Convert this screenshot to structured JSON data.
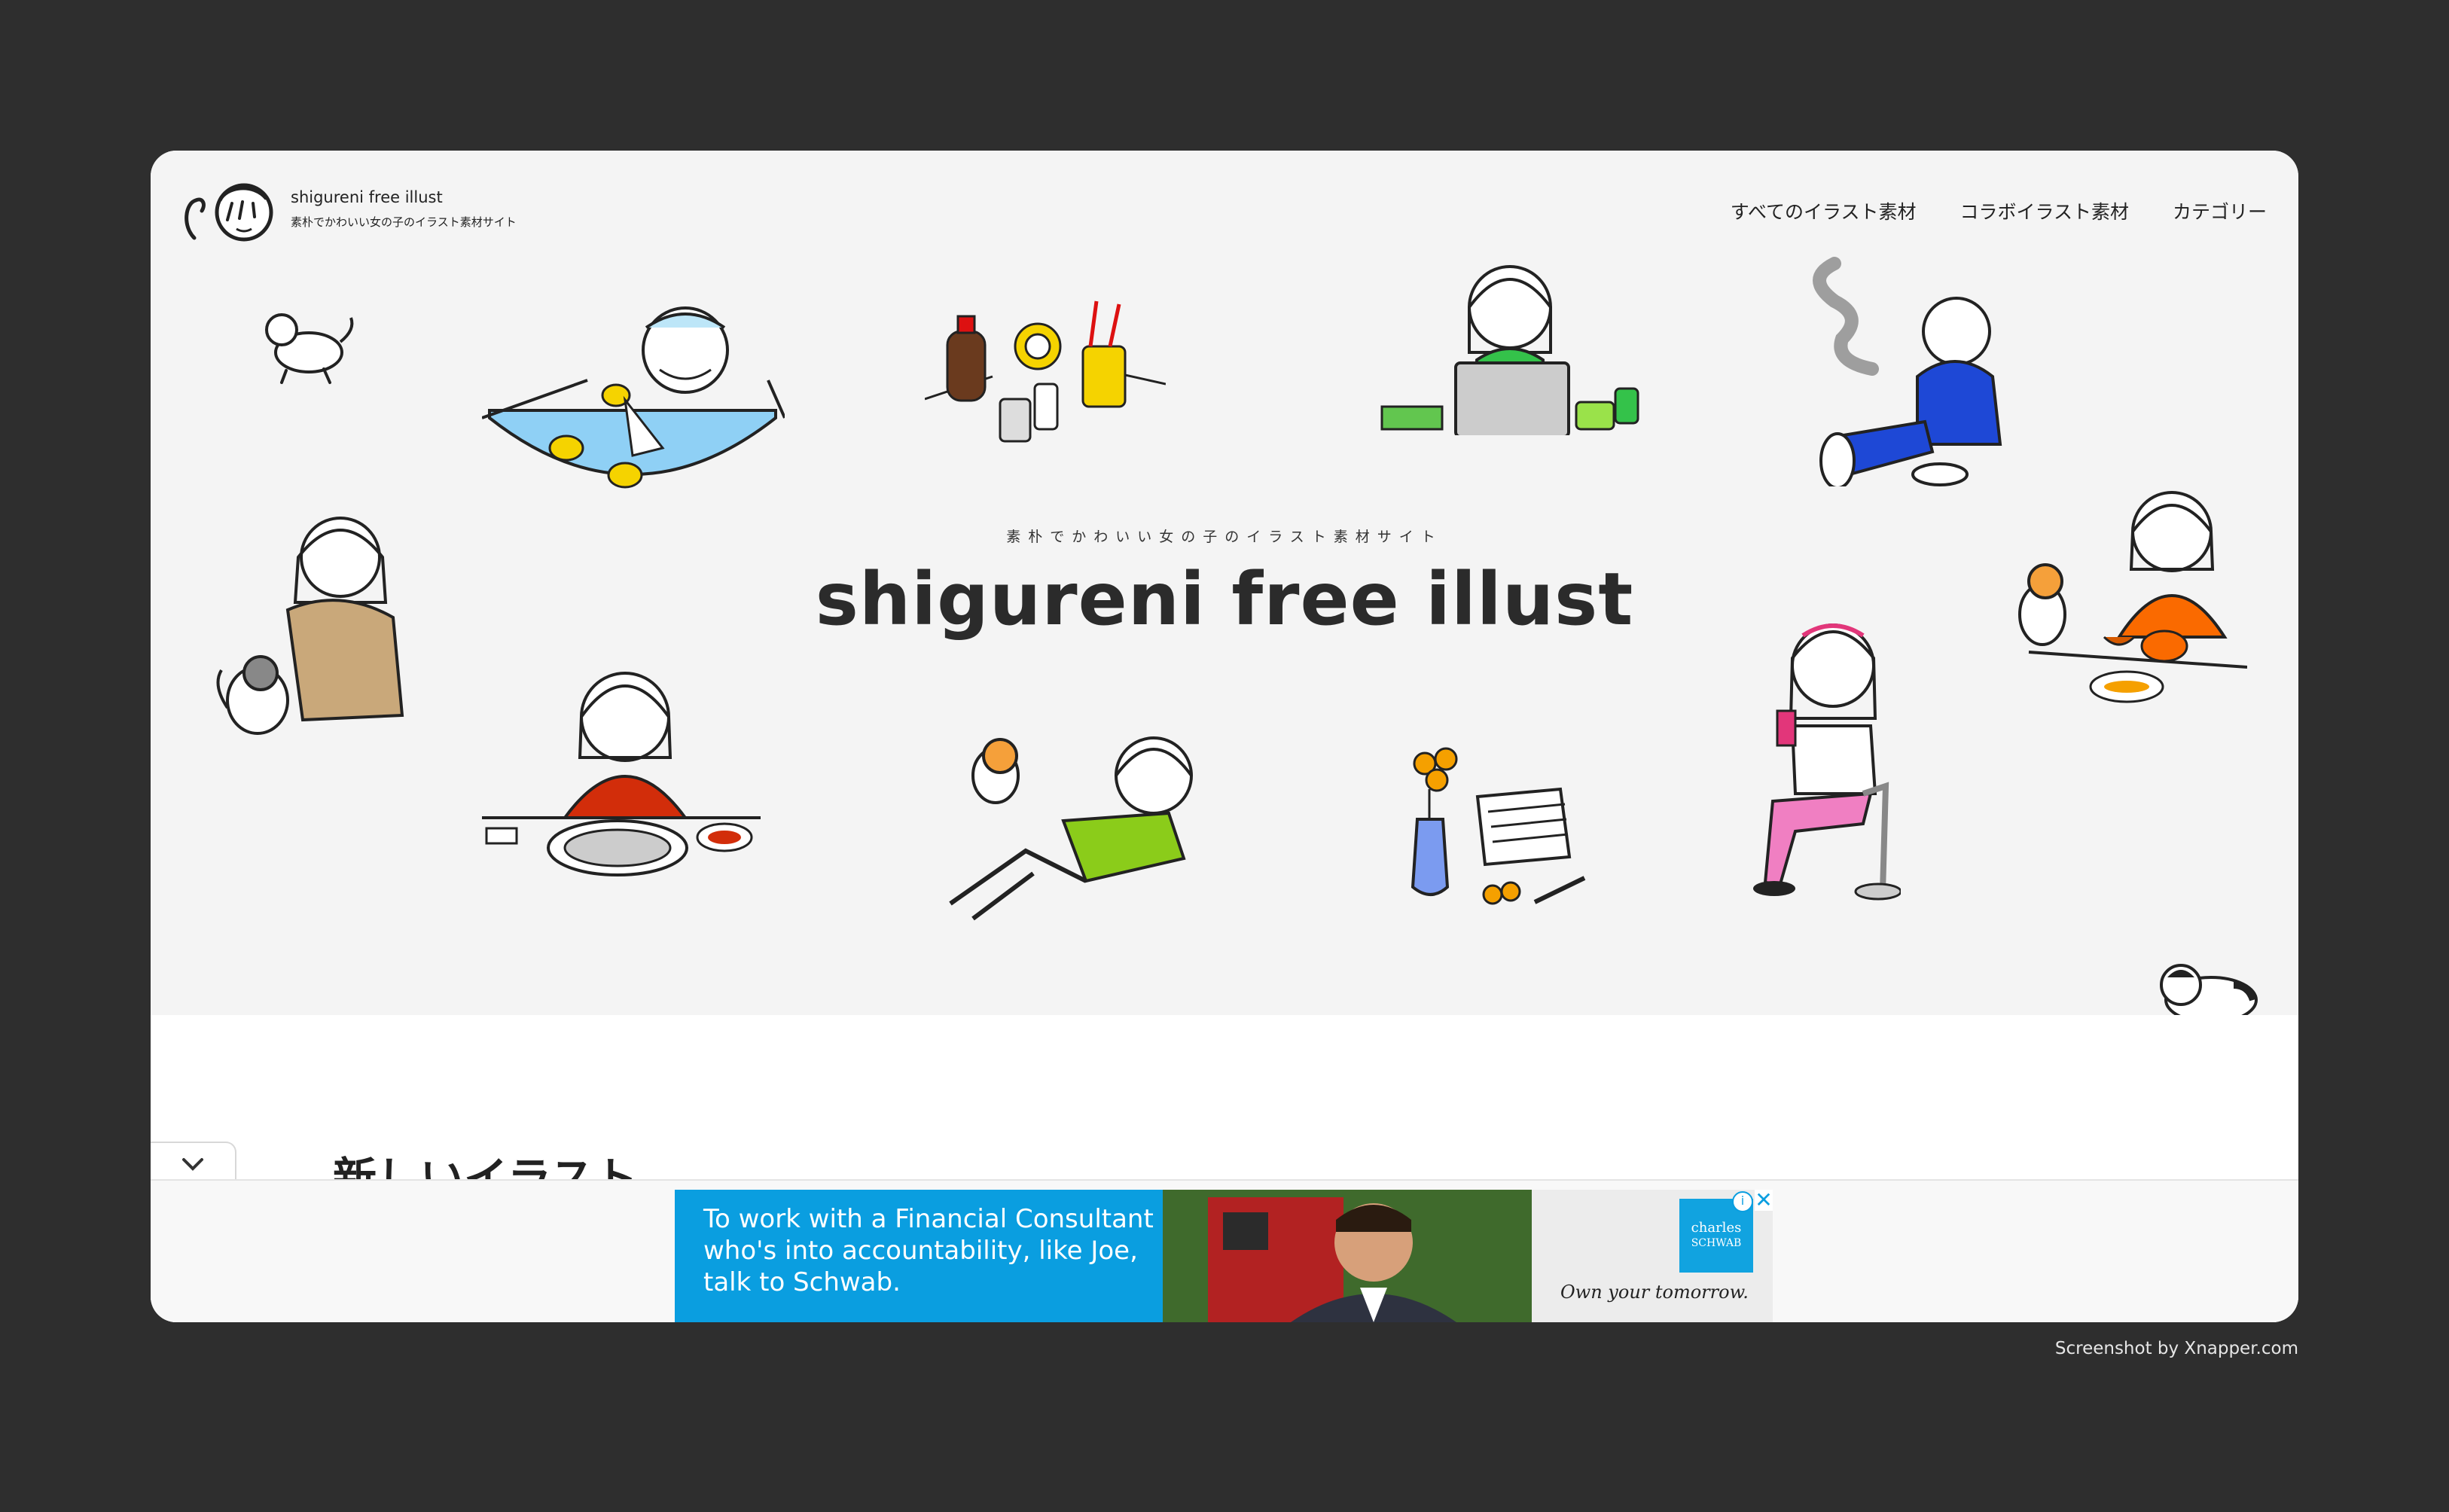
{
  "site": {
    "logo_title": "shigureni free illust",
    "logo_subtitle": "素朴でかわいい女の子のイラスト素材サイト",
    "tagline": "素朴でかわいい女の子のイラスト素材サイト",
    "title": "shigureni free illust"
  },
  "nav": {
    "items": [
      "すべてのイラスト素材",
      "コラボイラスト素材",
      "カテゴリー"
    ]
  },
  "content": {
    "section_heading": "新しいイラスト",
    "collapse_icon": "chevron-down-icon"
  },
  "ad": {
    "text": "To work with a Financial Consultant who's into accountability, like Joe, talk to Schwab.",
    "brand_line1": "charles",
    "brand_line2": "SCHWAB",
    "slogan": "Own your tomorrow.",
    "info_icon": "info-icon",
    "close_icon": "close-icon"
  },
  "credit": "Screenshot by Xnapper.com",
  "colors": {
    "background": "#2e2e2e",
    "hero": "#f4f4f4",
    "ad_blue": "#0a9ee0"
  }
}
